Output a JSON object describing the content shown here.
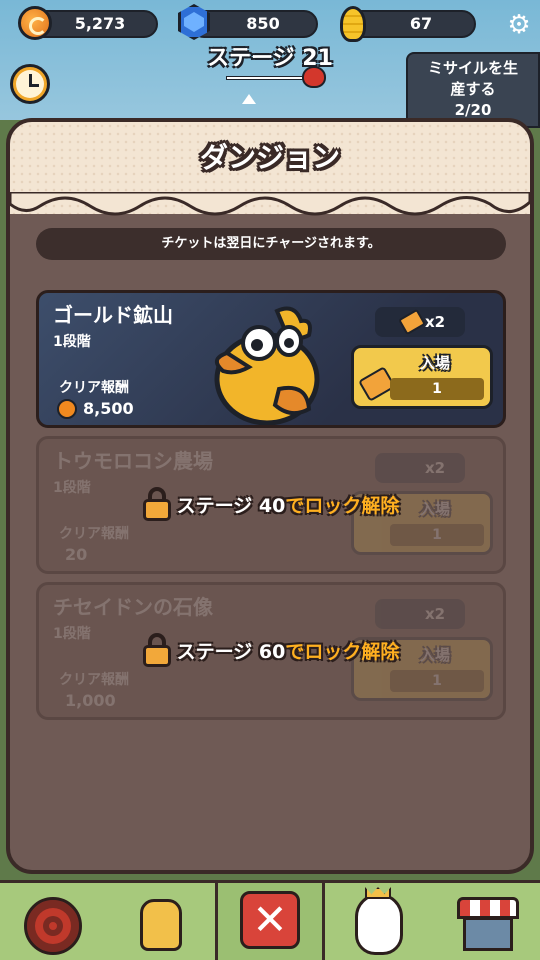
{
  "currencies": {
    "coins": "5,273",
    "gems": "850",
    "corn": "67"
  },
  "stage": {
    "title": "ステージ 21"
  },
  "missile": {
    "line1": "ミサイルを生",
    "line2": "産する",
    "progress": "2/20"
  },
  "panel": {
    "title": "ダンジョン",
    "notice": "チケットは翌日にチャージされます。"
  },
  "dungeons": [
    {
      "name": "ゴールド鉱山",
      "level": "1段階",
      "reward_label": "クリア報酬",
      "reward_value": "8,500",
      "tickets": "x2",
      "enter_label": "入場",
      "enter_cost": "1",
      "locked": false
    },
    {
      "name": "トウモロコシ農場",
      "level": "1段階",
      "reward_label": "クリア報酬",
      "reward_value": "20",
      "tickets": "x2",
      "enter_label": "入場",
      "enter_cost": "1",
      "locked": true,
      "lock_prefix": "ステージ 40",
      "lock_suffix": "でロック解除"
    },
    {
      "name": "チセイドンの石像",
      "level": "1段階",
      "reward_label": "クリア報酬",
      "reward_value": "1,000",
      "tickets": "x2",
      "enter_label": "入場",
      "enter_cost": "1",
      "locked": true,
      "lock_prefix": "ステージ 60",
      "lock_suffix": "でロック解除"
    }
  ],
  "nav": {
    "close_symbol": "✕"
  },
  "icons": {
    "settings": "gear-icon",
    "close": "close-icon"
  }
}
